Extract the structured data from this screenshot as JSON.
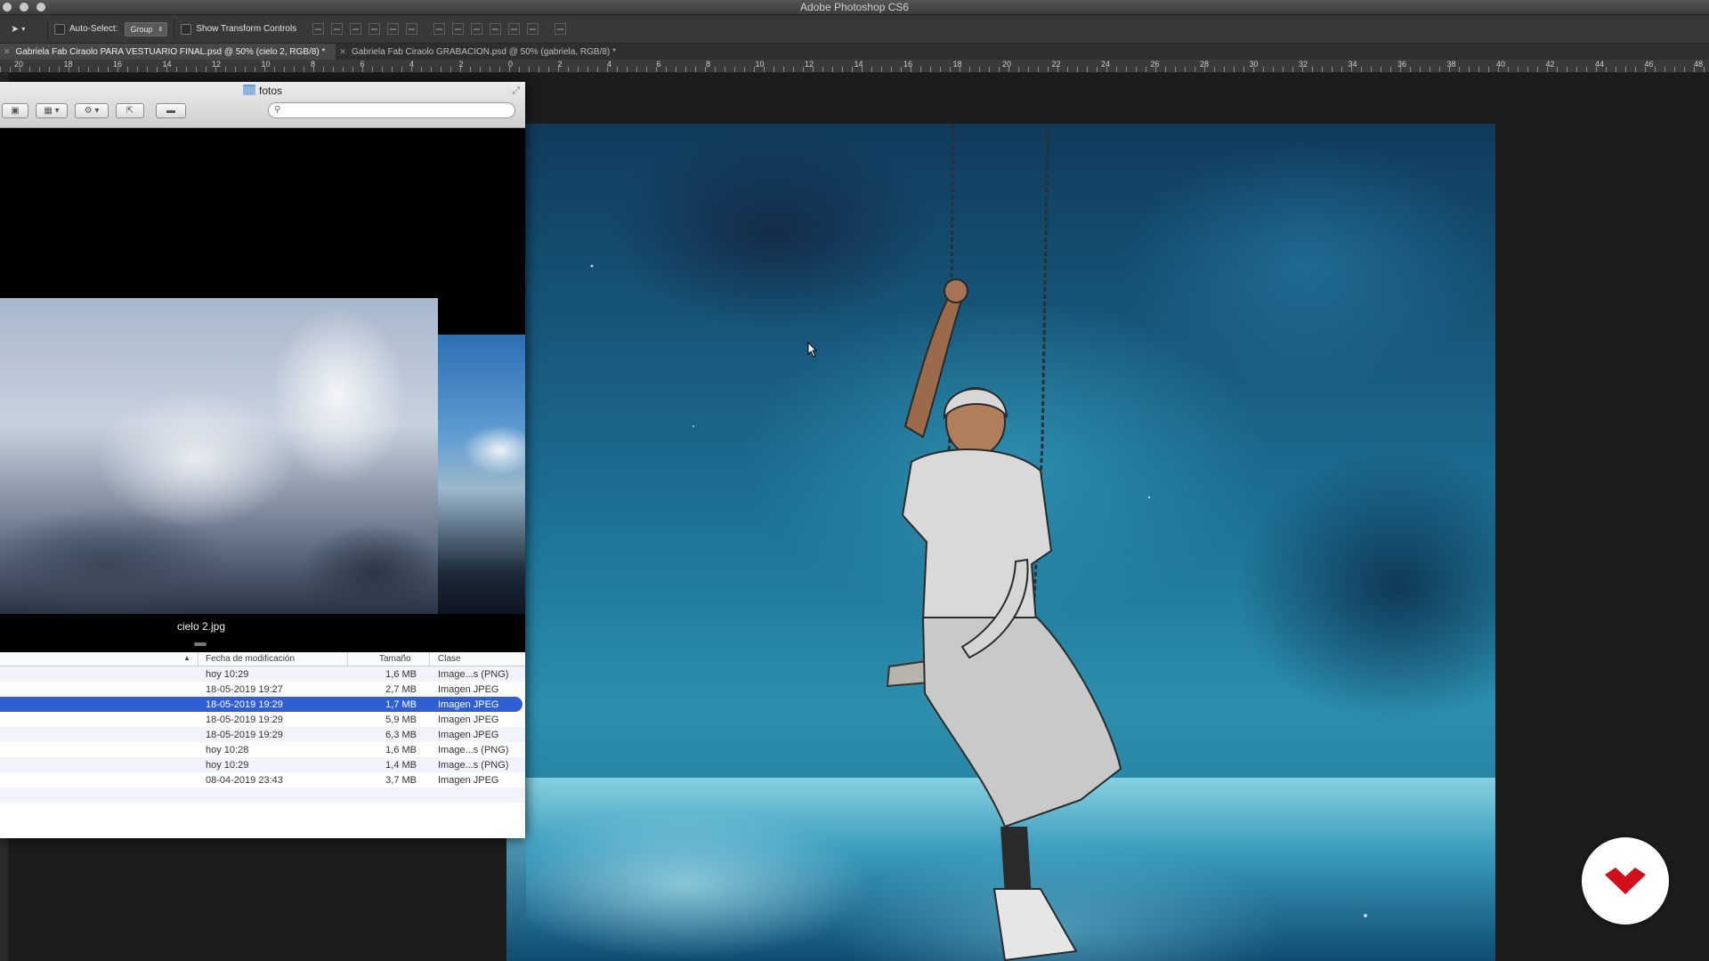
{
  "app": {
    "title": "Adobe Photoshop CS6"
  },
  "options": {
    "auto_select_label": "Auto-Select:",
    "auto_select_value": "Group",
    "transform_label": "Show Transform Controls"
  },
  "tabs": [
    {
      "label": "Gabriela Fab Ciraolo PARA VESTUARIO FINAL.psd @ 50% (cielo 2, RGB/8) *"
    },
    {
      "label": "Gabriela Fab Ciraolo GRABACION.psd @ 50% (gabriela, RGB/8) *"
    }
  ],
  "ruler": {
    "labels": [
      "20",
      "18",
      "16",
      "14",
      "12",
      "10",
      "8",
      "6",
      "4",
      "2",
      "0",
      "2",
      "4",
      "6",
      "8",
      "10",
      "12",
      "14",
      "16",
      "18",
      "20",
      "22",
      "24",
      "26",
      "28",
      "30",
      "32",
      "34",
      "36",
      "38",
      "40",
      "42",
      "44",
      "46",
      "48"
    ]
  },
  "finder": {
    "title": "fotos",
    "preview_caption": "cielo 2.jpg",
    "columns": {
      "date": "Fecha de modificación",
      "size": "Tamaño",
      "kind": "Clase"
    },
    "rows": [
      {
        "date": "hoy 10:29",
        "size": "1,6 MB",
        "kind": "Image...s (PNG)"
      },
      {
        "date": "18-05-2019 19:27",
        "size": "2,7 MB",
        "kind": "Imagen JPEG"
      },
      {
        "date": "18-05-2019 19:29",
        "size": "1,7 MB",
        "kind": "Imagen JPEG"
      },
      {
        "date": "18-05-2019 19:29",
        "size": "5,9 MB",
        "kind": "Imagen JPEG"
      },
      {
        "date": "18-05-2019 19:29",
        "size": "6,3 MB",
        "kind": "Imagen JPEG"
      },
      {
        "date": "hoy 10:28",
        "size": "1,6 MB",
        "kind": "Image...s (PNG)"
      },
      {
        "date": "hoy 10:29",
        "size": "1,4 MB",
        "kind": "Image...s (PNG)"
      },
      {
        "date": "08-04-2019 23:43",
        "size": "3,7 MB",
        "kind": "Imagen JPEG"
      }
    ],
    "selected_index": 2
  },
  "colors": {
    "selection": "#2f5fd3",
    "badge_red": "#d1101c"
  }
}
